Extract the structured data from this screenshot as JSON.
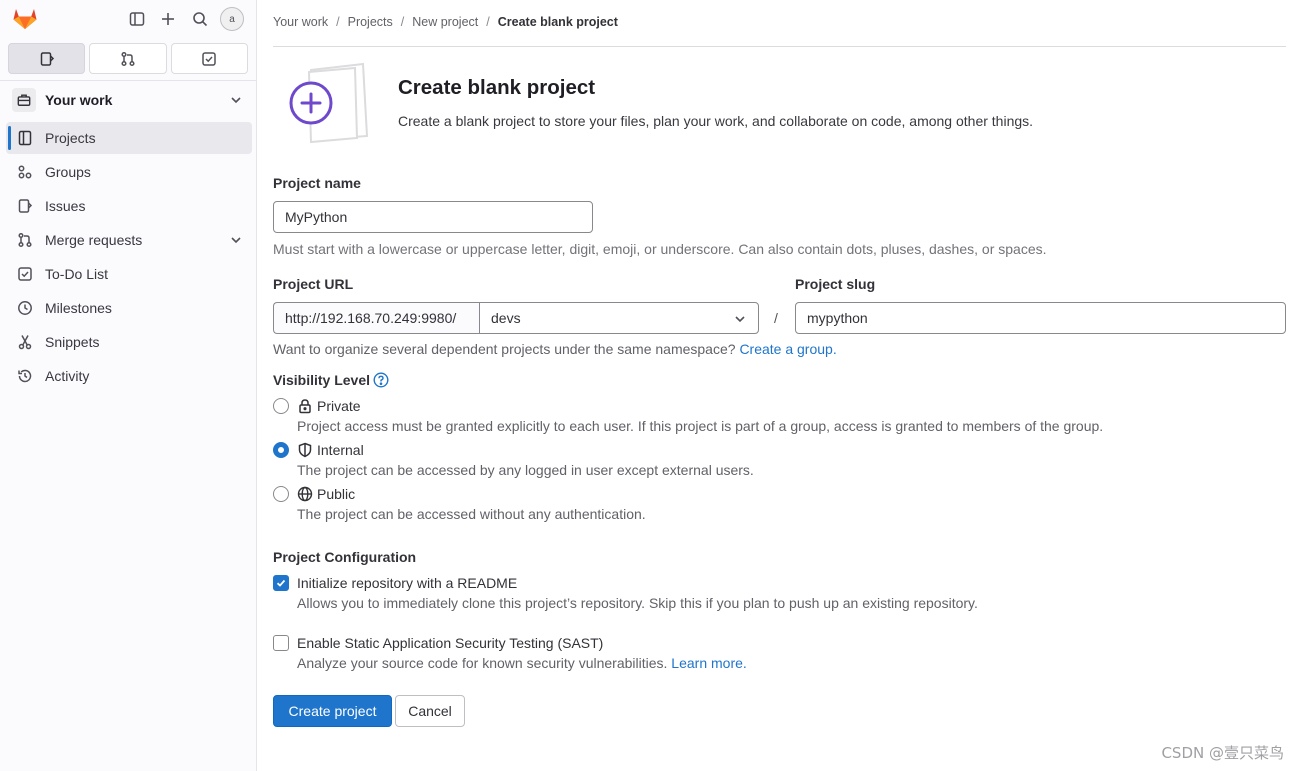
{
  "sidebar": {
    "avatar_alt": "a",
    "context": {
      "label": "Your work"
    },
    "items": [
      {
        "label": "Projects",
        "icon": "project-icon",
        "active": true
      },
      {
        "label": "Groups",
        "icon": "group-icon"
      },
      {
        "label": "Issues",
        "icon": "issues-icon"
      },
      {
        "label": "Merge requests",
        "icon": "merge-request-icon",
        "expandable": true
      },
      {
        "label": "To-Do List",
        "icon": "todo-icon"
      },
      {
        "label": "Milestones",
        "icon": "clock-icon"
      },
      {
        "label": "Snippets",
        "icon": "snippet-icon"
      },
      {
        "label": "Activity",
        "icon": "history-icon"
      }
    ]
  },
  "breadcrumb": [
    "Your work",
    "Projects",
    "New project",
    "Create blank project"
  ],
  "header": {
    "title": "Create blank project",
    "description": "Create a blank project to store your files, plan your work, and collaborate on code, among other things."
  },
  "form": {
    "project_name": {
      "label": "Project name",
      "value": "MyPython",
      "help": "Must start with a lowercase or uppercase letter, digit, emoji, or underscore. Can also contain dots, pluses, dashes, or spaces."
    },
    "project_url": {
      "label": "Project URL",
      "prefix": "http://192.168.70.249:9980/",
      "namespace": "devs",
      "separator": "/",
      "help_text": "Want to organize several dependent projects under the same namespace?",
      "help_link": "Create a group."
    },
    "project_slug": {
      "label": "Project slug",
      "value": "mypython"
    },
    "visibility": {
      "label": "Visibility Level",
      "options": [
        {
          "label": "Private",
          "description": "Project access must be granted explicitly to each user. If this project is part of a group, access is granted to members of the group.",
          "checked": false
        },
        {
          "label": "Internal",
          "description": "The project can be accessed by any logged in user except external users.",
          "checked": true
        },
        {
          "label": "Public",
          "description": "The project can be accessed without any authentication.",
          "checked": false
        }
      ]
    },
    "configuration": {
      "label": "Project Configuration",
      "readme": {
        "label": "Initialize repository with a README",
        "description": "Allows you to immediately clone this project’s repository. Skip this if you plan to push up an existing repository.",
        "checked": true
      },
      "sast": {
        "label": "Enable Static Application Security Testing (SAST)",
        "description": "Analyze your source code for known security vulnerabilities.",
        "link": "Learn more.",
        "checked": false
      }
    },
    "create_button": "Create project",
    "cancel_button": "Cancel"
  },
  "watermark": "CSDN @壹只菜鸟",
  "colors": {
    "accent": "#1f75cb",
    "brand_orange": "#e24329",
    "illustration_purple": "#6e49cb"
  }
}
